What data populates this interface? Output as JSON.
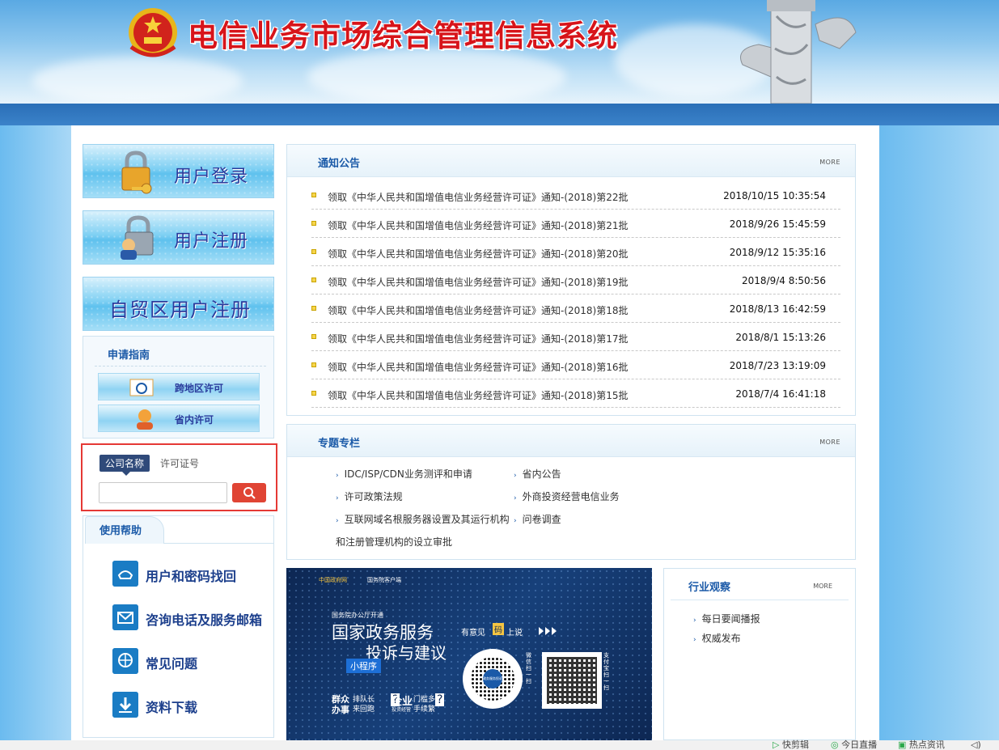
{
  "header": {
    "title": "电信业务市场综合管理信息系统",
    "emblem_icon": "national-emblem-icon",
    "pillar_icon": "huabiao-pillar-icon"
  },
  "left": {
    "login_label": "用户登录",
    "register_label": "用户注册",
    "ftz_register_label": "自贸区用户注册",
    "guide": {
      "title": "申请指南",
      "cross_region": "跨地区许可",
      "in_province": "省内许可"
    },
    "search": {
      "tab_company": "公司名称",
      "tab_license": "许可证号",
      "input_value": ""
    },
    "help": {
      "title": "使用帮助",
      "items": [
        {
          "label": "用户和密码找回",
          "icon": "phone-icon"
        },
        {
          "label": "咨询电话及服务邮箱",
          "icon": "mail-icon"
        },
        {
          "label": "常见问题",
          "icon": "globe-icon"
        },
        {
          "label": "资料下载",
          "icon": "download-icon"
        }
      ]
    }
  },
  "notices": {
    "title": "通知公告",
    "more": "MORE",
    "items": [
      {
        "title": "领取《中华人民共和国增值电信业务经营许可证》通知-(2018)第22批",
        "date": "2018/10/15 10:35:54"
      },
      {
        "title": "领取《中华人民共和国增值电信业务经营许可证》通知-(2018)第21批",
        "date": "2018/9/26 15:45:59"
      },
      {
        "title": "领取《中华人民共和国增值电信业务经营许可证》通知-(2018)第20批",
        "date": "2018/9/12 15:35:16"
      },
      {
        "title": "领取《中华人民共和国增值电信业务经营许可证》通知-(2018)第19批",
        "date": "2018/9/4 8:50:56"
      },
      {
        "title": "领取《中华人民共和国增值电信业务经营许可证》通知-(2018)第18批",
        "date": "2018/8/13 16:42:59"
      },
      {
        "title": "领取《中华人民共和国增值电信业务经营许可证》通知-(2018)第17批",
        "date": "2018/8/1 15:13:26"
      },
      {
        "title": "领取《中华人民共和国增值电信业务经营许可证》通知-(2018)第16批",
        "date": "2018/7/23 13:19:09"
      },
      {
        "title": "领取《中华人民共和国增值电信业务经营许可证》通知-(2018)第15批",
        "date": "2018/7/4 16:41:18"
      }
    ]
  },
  "topics": {
    "title": "专题专栏",
    "more": "MORE",
    "items": [
      "IDC/ISP/CDN业务测评和申请",
      "省内公告",
      "许可政策法规",
      "外商投资经营电信业务",
      "互联网域名根服务器设置及其运行机构",
      "问卷调查"
    ],
    "continuation": "和注册管理机构的设立审批"
  },
  "promo": {
    "gov_logo": "中国政府网",
    "app_logo": "国务院客户端",
    "tagline": "国务院办公厅开通",
    "line1": "国家政务服务",
    "line2": "投诉与建议",
    "badge": "小程序",
    "suggest": "有意见",
    "suggest_box": "码",
    "suggest_tail": "上说",
    "wechat_scan": "微信扫一扫",
    "alipay_scan": "支付宝扫一扫",
    "qr_center": "政务服务投诉",
    "slogan1_a": "群众",
    "slogan1_b": "办事",
    "slogan1_c": "排队长",
    "slogan1_d": "来回跑",
    "slogan2_a": "企业",
    "slogan2_b": "投资经营",
    "slogan2_c": "门槛多",
    "slogan2_d": "手续繁"
  },
  "industry": {
    "title": "行业观察",
    "more": "MORE",
    "items": [
      "每日要闻播报",
      "权威发布"
    ]
  },
  "statusbar": {
    "items": [
      "快剪辑",
      "今日直播",
      "热点资讯"
    ]
  },
  "colors": {
    "title_red": "#d7141a",
    "link_blue": "#1b5aa8",
    "nav_blue": "#2a6fb7",
    "search_red": "#e04434",
    "highlight_border": "#e53935"
  }
}
